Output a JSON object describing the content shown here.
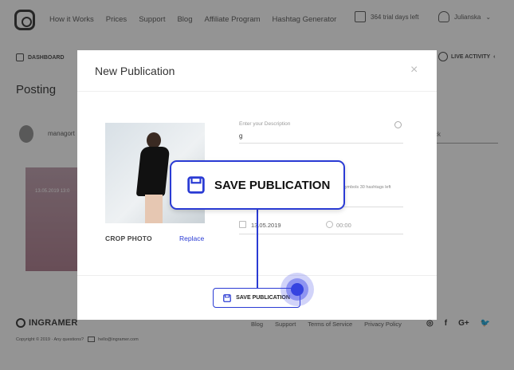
{
  "header": {
    "nav_items": [
      "How it Works",
      "Prices",
      "Support",
      "Blog",
      "Affiliate Program",
      "Hashtag Generator"
    ],
    "trial": "364 trial days left",
    "user": "Julianska"
  },
  "subbar": {
    "dashboard": "DASHBOARD",
    "live_activity": "LIVE ACTIVITY"
  },
  "page": {
    "title": "Posting",
    "account": "managort",
    "right_select": "ck",
    "thumb_date": "13.05.2019 13:0"
  },
  "modal": {
    "title": "New Publication",
    "close": "×",
    "crop_label": "CROP PHOTO",
    "replace_label": "Replace",
    "description_label": "Enter your Description",
    "description_value": "g",
    "hashtags_hint": "symbols 30 hashtags left",
    "date": "13.05.2019",
    "time": "00:00"
  },
  "buttons": {
    "save_small": "SAVE PUBLICATION",
    "save_big": "SAVE PUBLICATION"
  },
  "footer": {
    "brand": "INGRAMER",
    "links": [
      "Blog",
      "Support",
      "Terms of Service",
      "Privacy Policy"
    ],
    "social": [
      "◎",
      "f",
      "G+",
      "🐦"
    ],
    "copyright": "Copyright © 2019 · Any questions?",
    "email": "hello@ingramer.com"
  },
  "colors": {
    "accent": "#2a3bd4",
    "overlay": "rgba(0,0,0,0.42)"
  }
}
